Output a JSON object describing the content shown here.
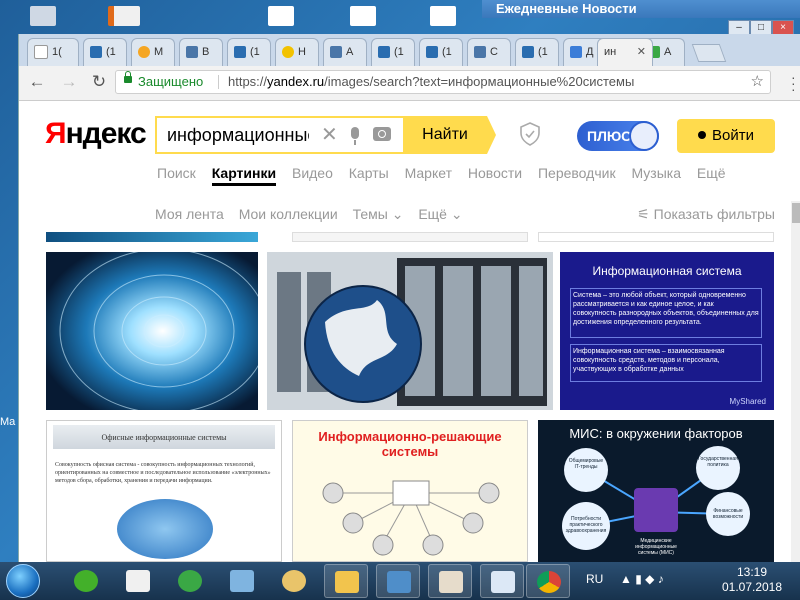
{
  "desktop": {
    "news_title": "Ежедневные Новости",
    "left_label": "Ma"
  },
  "browser": {
    "tabs": [
      {
        "label": "1("
      },
      {
        "label": "(1"
      },
      {
        "label": "M"
      },
      {
        "label": "B"
      },
      {
        "label": "(1"
      },
      {
        "label": "H"
      },
      {
        "label": "A"
      },
      {
        "label": "(1"
      },
      {
        "label": "(1"
      },
      {
        "label": "C"
      },
      {
        "label": "(1"
      },
      {
        "label": "Д"
      },
      {
        "label": "ин"
      },
      {
        "label": "A"
      }
    ],
    "secure_label": "Защищено",
    "url_scheme": "https://",
    "url_host": "yandex.ru",
    "url_path": "/images/search?text=информационные%20системы"
  },
  "yandex": {
    "logo_y": "Я",
    "logo_rest": "ндекс",
    "search_value": "информационные",
    "find_label": "Найти",
    "plus_label": "ПЛЮС",
    "login_label": "Войти",
    "services": [
      "Поиск",
      "Картинки",
      "Видео",
      "Карты",
      "Маркет",
      "Новости",
      "Переводчик",
      "Музыка",
      "Ещё"
    ],
    "subnav": [
      "Моя лента",
      "Мои коллекции",
      "Темы ⌄",
      "Ещё ⌄"
    ],
    "filters_label": "Показать фильтры"
  },
  "results": {
    "card3": {
      "title": "Информационная система",
      "def1": "Система – это любой объект, который одновременно рассматривается и как единое целое, и как совокупность разнородных объектов, объединенных для достижения определенного результата.",
      "def2": "Информационная система – взаимосвязанная совокупность средств, методов и персонала, участвующих в обработке данных",
      "credit": "MyShared"
    },
    "card4": {
      "title": "Офисные информационные системы",
      "text": "Совокупность офисная система - совокупность информационных технологий, ориентированных на совместное и последовательное использование «электронных» методов сбора, обработки, хранения и передачи информации."
    },
    "card5": {
      "title": "Информационно-решающие системы"
    },
    "card6": {
      "title": "МИС: в окружении факторов",
      "nodes": [
        "Общемировые IT-тренды",
        "Государственная политика",
        "Потребности практического здравоохранения",
        "Финансовые возможности",
        "Медицинские информационные системы (МИС)"
      ]
    }
  },
  "taskbar": {
    "lang": "RU",
    "time": "13:19",
    "date": "01.07.2018"
  }
}
